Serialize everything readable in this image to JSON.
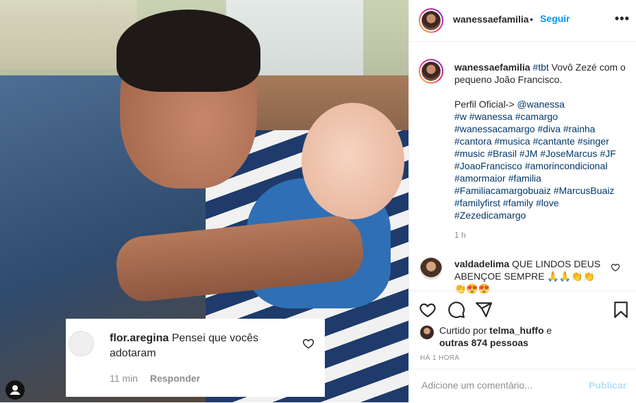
{
  "post": {
    "username": "wanessaefamilia",
    "follow_label": "Seguir",
    "separator": "•",
    "more_label": "•••",
    "caption_line1_tag": "#tbt",
    "caption_line1_text": " Vovô Zezé com o pequeno João Francisco.",
    "caption_profile_label": "Perfil Oficial->",
    "caption_profile_mention": "@wanessa",
    "hashtags": "#w #wanessa #camargo #wanessacamargo #diva #rainha #cantora #musica #cantante #singer #music #Brasil #JM #JoseMarcus #JF #JoaoFrancisco #amorincondicional #amormaior #familia #Familiacamargobuaiz #MarcusBuaiz #familyfirst #family #love #Zezedicamargo",
    "time": "1 h"
  },
  "comments": [
    {
      "username": "valdadelima",
      "text": "QUE LINDOS DEUS ABENÇOE SEMPRE 🙏🙏👏👏👏😍😍"
    }
  ],
  "photo_overlay": {
    "username": "flor.aregina",
    "text": "Pensei que vocês adotaram",
    "time": "11 min",
    "reply_label": "Responder"
  },
  "likes": {
    "prefix": "Curtido por",
    "user": "telma_huffo",
    "conj": "e",
    "others": "outras 874 pessoas"
  },
  "posted_ago": "HÁ 1 HORA",
  "add_comment": {
    "placeholder": "Adicione um comentário...",
    "publish_label": "Publicar"
  },
  "icons": [
    "heart-icon",
    "comment-icon",
    "share-icon",
    "bookmark-icon",
    "more-icon",
    "user-tag-icon"
  ],
  "colors": {
    "link": "#00376b",
    "follow": "#0095f6",
    "publish_disabled": "#b2dffc",
    "muted": "#8e8e8e"
  }
}
